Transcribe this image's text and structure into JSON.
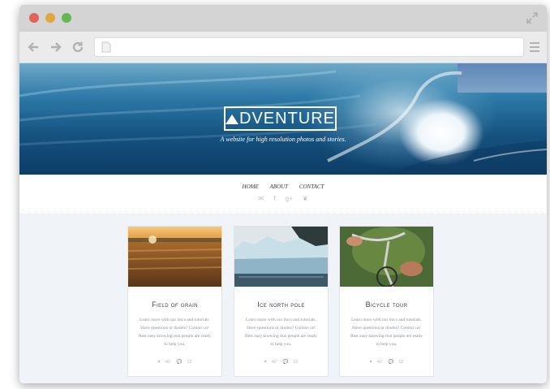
{
  "browser": {
    "url": ""
  },
  "hero": {
    "logo_text": "DVENTURE",
    "tagline": "A website for high resolution photos and stories."
  },
  "nav": {
    "items": [
      "HOME",
      "ABOUT",
      "CONTACT"
    ]
  },
  "social": {
    "icons": [
      "mail-icon",
      "facebook-icon",
      "google-plus-icon",
      "twitter-icon"
    ],
    "glyphs": [
      "✉",
      "f",
      "g+",
      "❦"
    ]
  },
  "cards": [
    {
      "title": "Field of grain",
      "body": "Learn more with our docs and tutorials. Have questions or doubts? Contact us! Rest easy knowing real people are ready to help you.",
      "likes": "42",
      "comments": "12"
    },
    {
      "title": "Ice north pole",
      "body": "Learn more with our docs and tutorials. Have questions or doubts? Contact us! Rest easy knowing real people are ready to help you.",
      "likes": "42",
      "comments": "12"
    },
    {
      "title": "Bicycle tour",
      "body": "Learn more with our docs and tutorials. Have questions or doubts? Contact us! Rest easy knowing real people are ready to help you.",
      "likes": "42",
      "comments": "12"
    }
  ],
  "colors": {
    "close": "#e2625c",
    "minimize": "#e2a63f",
    "maximize": "#62b950",
    "page_background": "#f0f3f7"
  }
}
